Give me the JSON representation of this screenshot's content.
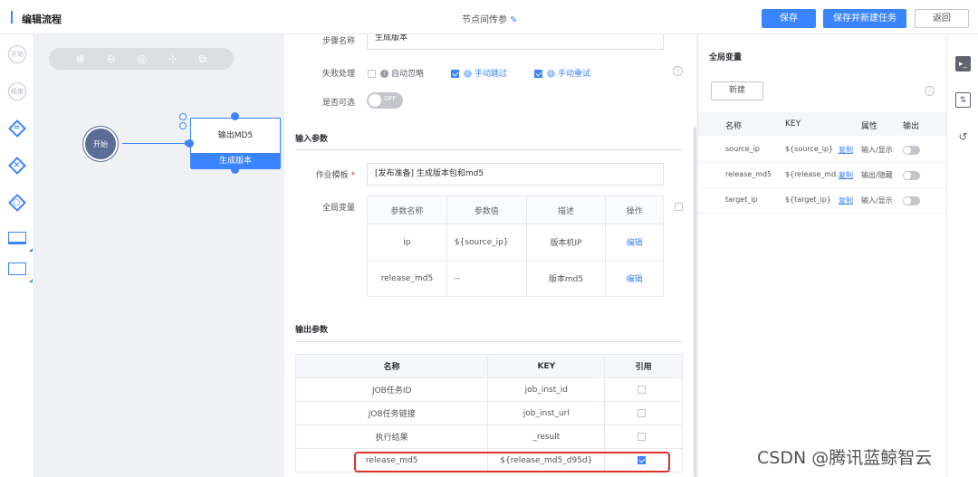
{
  "header": {
    "title": "编辑流程",
    "node_name": "节点间传参",
    "save_label": "保存",
    "save_new_label": "保存并新建任务",
    "back_label": "返回"
  },
  "palette": {
    "start_label": "开始",
    "end_label": "结束",
    "gateway_parallel": "=",
    "gateway_branch": "×",
    "gateway_converge": "○"
  },
  "canvas": {
    "start_node": "开始",
    "task_node_title": "输出MD5",
    "task_node_step": "生成版本"
  },
  "form": {
    "step_name_label": "步骤名称",
    "step_name_value": "生成版本",
    "fail_label": "失败处理",
    "auto_ignore": "自动忽略",
    "manual_skip": "手动跳过",
    "manual_retry": "手动重试",
    "optional_label": "是否可选",
    "toggle_off": "OFF",
    "input_section": "输入参数",
    "template_label": "作业模板",
    "template_value": "[发布准备] 生成版本包和md5",
    "global_var_label": "全局变量",
    "input_table": {
      "headers": [
        "参数名称",
        "参数值",
        "描述",
        "操作"
      ],
      "rows": [
        {
          "name": "ip",
          "value": "${source_ip}",
          "desc": "版本机IP",
          "op": "编辑"
        },
        {
          "name": "release_md5",
          "value": "--",
          "desc": "版本md5",
          "op": "编辑"
        }
      ]
    },
    "output_section": "输出参数",
    "output_table": {
      "headers": [
        "名称",
        "KEY",
        "引用"
      ],
      "rows": [
        {
          "name": "JOB任务ID",
          "key": "job_inst_id",
          "checked": false
        },
        {
          "name": "JOB任务链接",
          "key": "job_inst_url",
          "checked": false
        },
        {
          "name": "执行结果",
          "key": "_result",
          "checked": false
        },
        {
          "name": "release_md5",
          "key": "${release_md5_d95d}",
          "checked": true
        }
      ]
    }
  },
  "variables": {
    "title": "全局变量",
    "new_label": "新建",
    "help": "i",
    "headers": [
      "名称",
      "KEY",
      "属性",
      "输出"
    ],
    "rows": [
      {
        "name": "source_ip",
        "key": "${source_ip}",
        "copy": "复制",
        "attr": "输入/显示"
      },
      {
        "name": "release_md5",
        "key": "${release_md...",
        "copy": "复制",
        "attr": "输出/隐藏"
      },
      {
        "name": "target_ip",
        "key": "${target_ip}",
        "copy": "复制",
        "attr": "输入/显示"
      }
    ]
  },
  "watermark": "CSDN @腾讯蓝鲸智云",
  "colors": {
    "accent": "#3a84ff",
    "highlight_box": "#e1312b",
    "start_node": "#5b6c96"
  }
}
